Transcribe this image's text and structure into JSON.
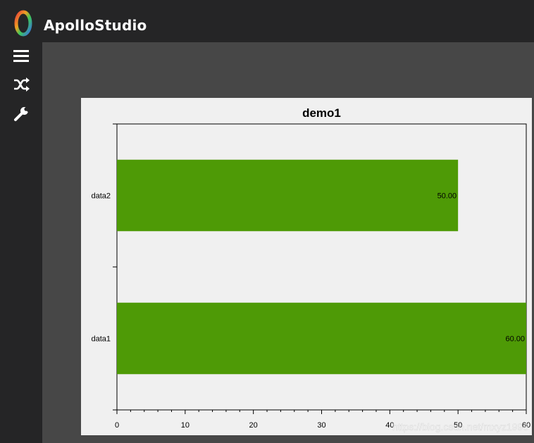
{
  "app": {
    "title": "ApolloStudio"
  },
  "sidebar": {
    "items": [
      {
        "icon": "hamburger-menu-icon"
      },
      {
        "icon": "shuffle-icon"
      },
      {
        "icon": "wrench-icon"
      }
    ]
  },
  "watermark": "https://blog.csdn.net/mxyz1996",
  "colors": {
    "background": "#252526",
    "workspace": "#474747",
    "panel": "#f0f0f0",
    "bar": "#4e9a06"
  },
  "chart_data": {
    "type": "bar",
    "orientation": "horizontal",
    "title": "demo1",
    "categories": [
      "data2",
      "data1"
    ],
    "values": [
      50,
      60
    ],
    "value_labels": [
      "50.00",
      "60.00"
    ],
    "xlim": [
      0,
      60
    ],
    "x_ticks": [
      0,
      10,
      20,
      30,
      40,
      50,
      60
    ],
    "xlabel": "",
    "ylabel": "",
    "grid": false,
    "bar_color": "#4e9a06"
  }
}
